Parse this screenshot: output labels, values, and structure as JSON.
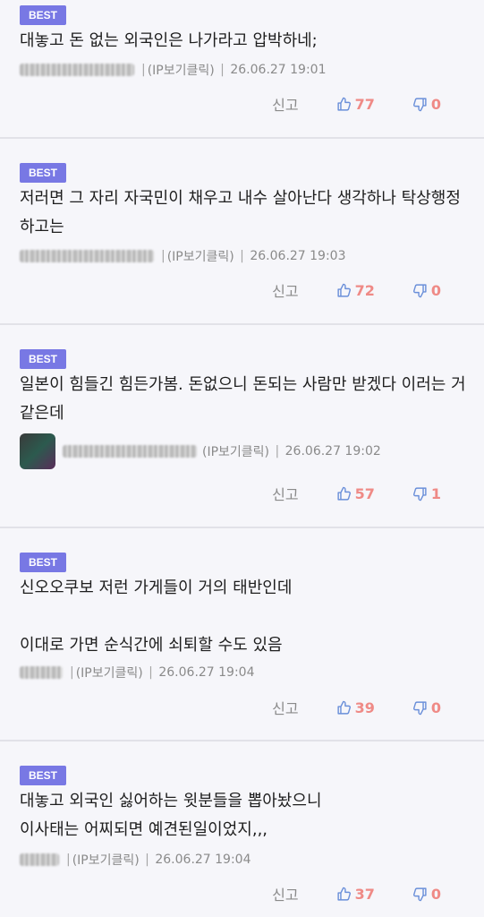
{
  "comments": [
    {
      "badge": "BEST",
      "text": "대놓고 돈 없는 외국인은 나가라고 압박하네;",
      "ip_label": "(IP보기클릭)",
      "date": "26.06.27 19:01",
      "report": "신고",
      "likes": "77",
      "dislikes": "0"
    },
    {
      "badge": "BEST",
      "text": "저러면 그 자리 자국민이 채우고 내수 살아난다 생각하나 탁상행정 하고는",
      "ip_label": "(IP보기클릭)",
      "date": "26.06.27 19:03",
      "report": "신고",
      "likes": "72",
      "dislikes": "0"
    },
    {
      "badge": "BEST",
      "text": "일본이 힘들긴 힘든가봄. 돈없으니 돈되는 사람만 받겠다 이러는 거같은데",
      "ip_label": "(IP보기클릭)",
      "date": "26.06.27 19:02",
      "report": "신고",
      "likes": "57",
      "dislikes": "1"
    },
    {
      "badge": "BEST",
      "text": "신오오쿠보 저런 가게들이 거의 태반인데\n\n이대로 가면 순식간에 쇠퇴할 수도 있음",
      "ip_label": "(IP보기클릭)",
      "date": "26.06.27 19:04",
      "report": "신고",
      "likes": "39",
      "dislikes": "0"
    },
    {
      "badge": "BEST",
      "text": "대놓고 외국인 싫어하는 윗분들을 뽑아놨으니\n이사태는 어찌되면 예견된일이었지,,,",
      "ip_label": "(IP보기클릭)",
      "date": "26.06.27 19:04",
      "report": "신고",
      "likes": "37",
      "dislikes": "0"
    }
  ],
  "icons": {
    "like": "thumbs-up-icon",
    "dislike": "thumbs-down-icon"
  },
  "colors": {
    "badge": "#7878e4",
    "vote": "#ef8a86",
    "background": "#f6f6fa"
  }
}
